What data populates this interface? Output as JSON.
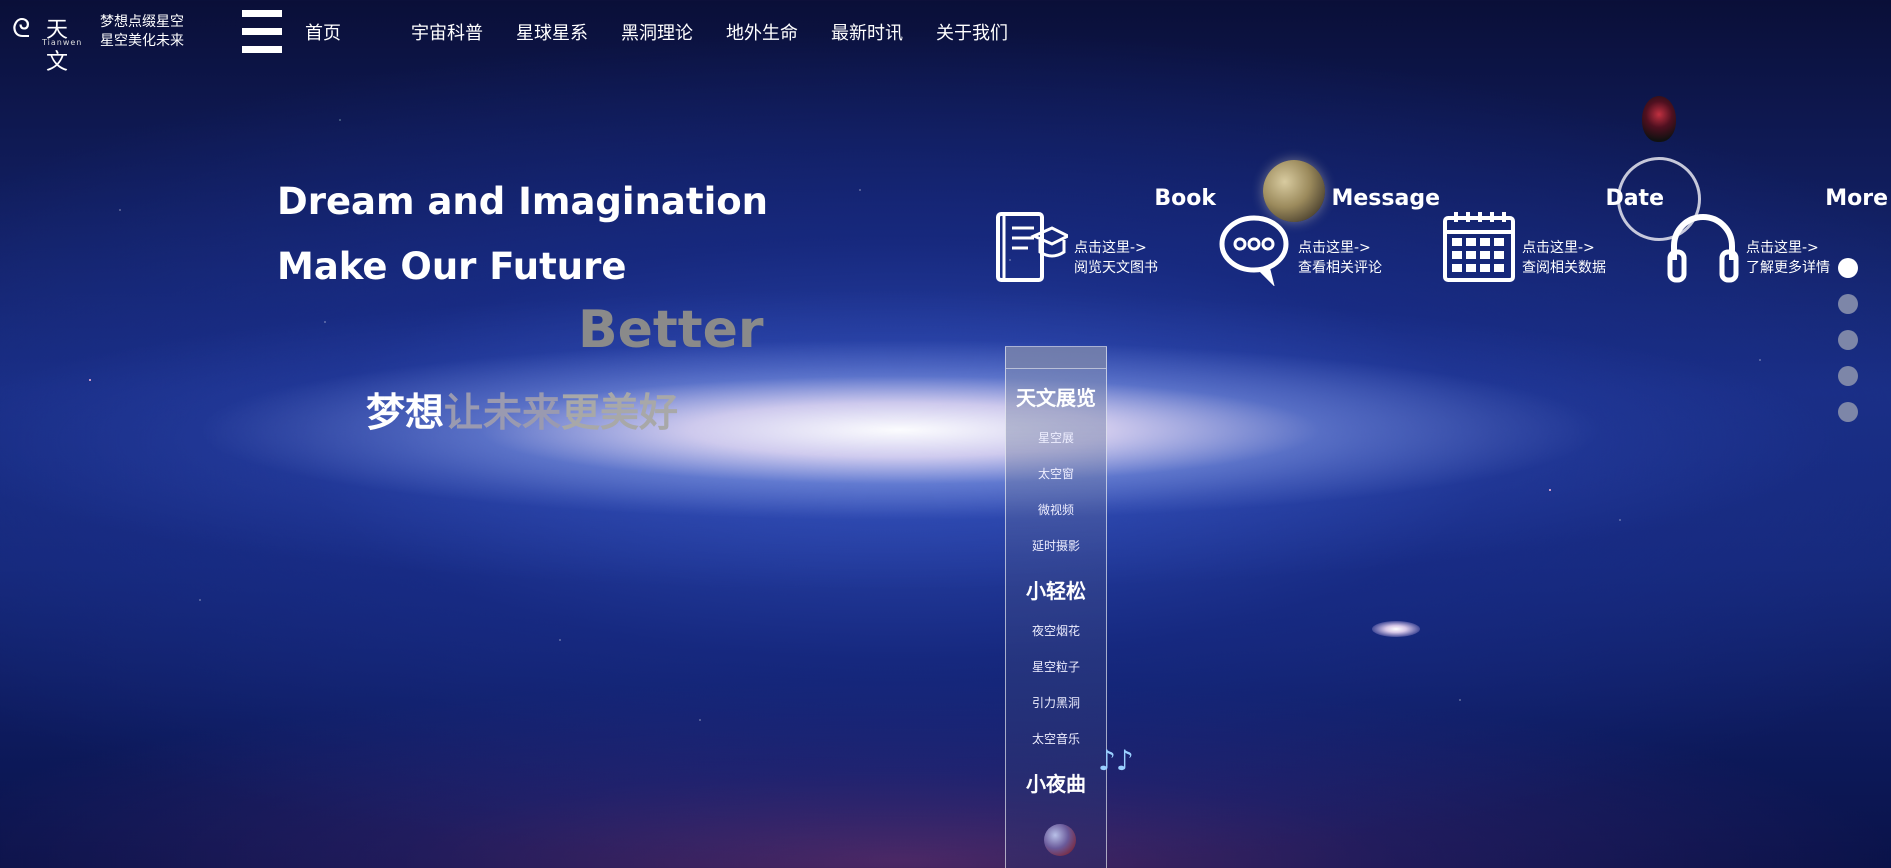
{
  "header": {
    "logo": {
      "word": "天文",
      "sub": "Tianwen"
    },
    "slogan": [
      "梦想点缀星空",
      "星空美化未来"
    ],
    "nav": [
      {
        "label": "首页"
      },
      {
        "label": "宇宙科普"
      },
      {
        "label": "星球星系"
      },
      {
        "label": "黑洞理论"
      },
      {
        "label": "地外生命"
      },
      {
        "label": "最新时讯"
      },
      {
        "label": "关于我们"
      }
    ]
  },
  "hero": {
    "line1": "Dream and Imagination",
    "line2": "Make Our Future",
    "better": "Better",
    "cn": {
      "part1": "梦想",
      "part2": "让未来",
      "part3": "更美好"
    }
  },
  "cards": [
    {
      "title": "Book",
      "line1": "点击这里->",
      "line2": "阅览天文图书",
      "icon": "book-icon"
    },
    {
      "title": "Message",
      "line1": "点击这里->",
      "line2": "查看相关评论",
      "icon": "chat-icon"
    },
    {
      "title": "Date",
      "line1": "点击这里->",
      "line2": "查阅相关数据",
      "icon": "calendar-icon"
    },
    {
      "title": "More",
      "line1": "点击这里->",
      "line2": "了解更多详情",
      "icon": "headphones-icon"
    }
  ],
  "side_dots": {
    "count": 5,
    "active_index": 0
  },
  "vertical_menu": {
    "sections": [
      {
        "heading": "天文展览",
        "items": [
          "星空展",
          "太空窗",
          "微视频",
          "延时摄影"
        ]
      },
      {
        "heading": "小轻松",
        "items": [
          "夜空烟花",
          "星空粒子",
          "引力黑洞",
          "太空音乐"
        ]
      },
      {
        "heading": "小夜曲",
        "items": []
      }
    ]
  },
  "decorations": {
    "music_notes": "♪♪"
  }
}
